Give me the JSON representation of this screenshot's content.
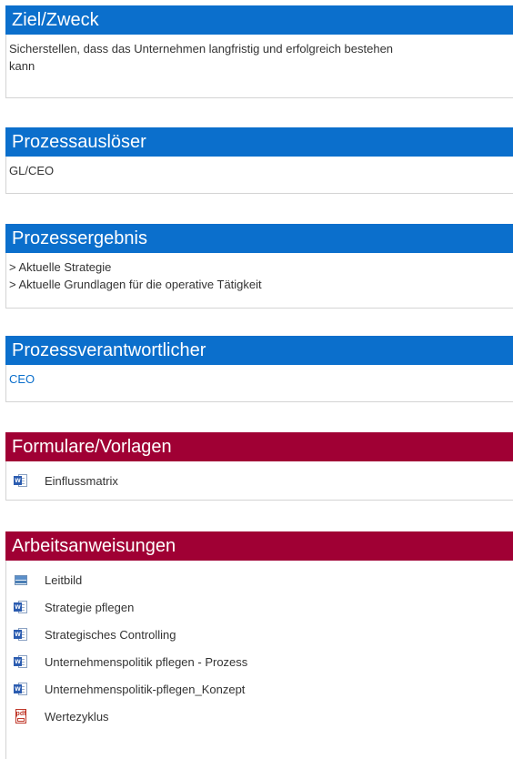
{
  "sections": {
    "ziel": {
      "title": "Ziel/Zweck",
      "text": "Sicherstellen, dass das Unternehmen langfristig und erfolgreich bestehen",
      "text2": "kann"
    },
    "ausloeser": {
      "title": "Prozessauslöser",
      "text": "GL/CEO"
    },
    "ergebnis": {
      "title": "Prozessergebnis",
      "lines": [
        "> Aktuelle Strategie",
        "> Aktuelle Grundlagen für die operative Tätigkeit"
      ]
    },
    "verantwortlicher": {
      "title": "Prozessverantwortlicher",
      "link": "CEO"
    },
    "formulare": {
      "title": "Formulare/Vorlagen",
      "items": [
        {
          "label": "Einflussmatrix",
          "icon": "word-doc-icon"
        }
      ]
    },
    "arbeit": {
      "title": "Arbeitsanweisungen",
      "items": [
        {
          "label": "Leitbild",
          "icon": "image-icon"
        },
        {
          "label": "Strategie pflegen",
          "icon": "word-doc-icon"
        },
        {
          "label": "Strategisches Controlling",
          "icon": "word-doc-icon"
        },
        {
          "label": "Unternehmenspolitik pflegen - Prozess",
          "icon": "word-doc-icon"
        },
        {
          "label": "Unternehmenspolitik-pflegen_Konzept",
          "icon": "word-doc-icon"
        },
        {
          "label": "Wertezyklus",
          "icon": "pdf-icon"
        }
      ]
    }
  },
  "colors": {
    "blue_header": "#0b6fcc",
    "red_header": "#a00034",
    "link": "#0b6fcc"
  }
}
